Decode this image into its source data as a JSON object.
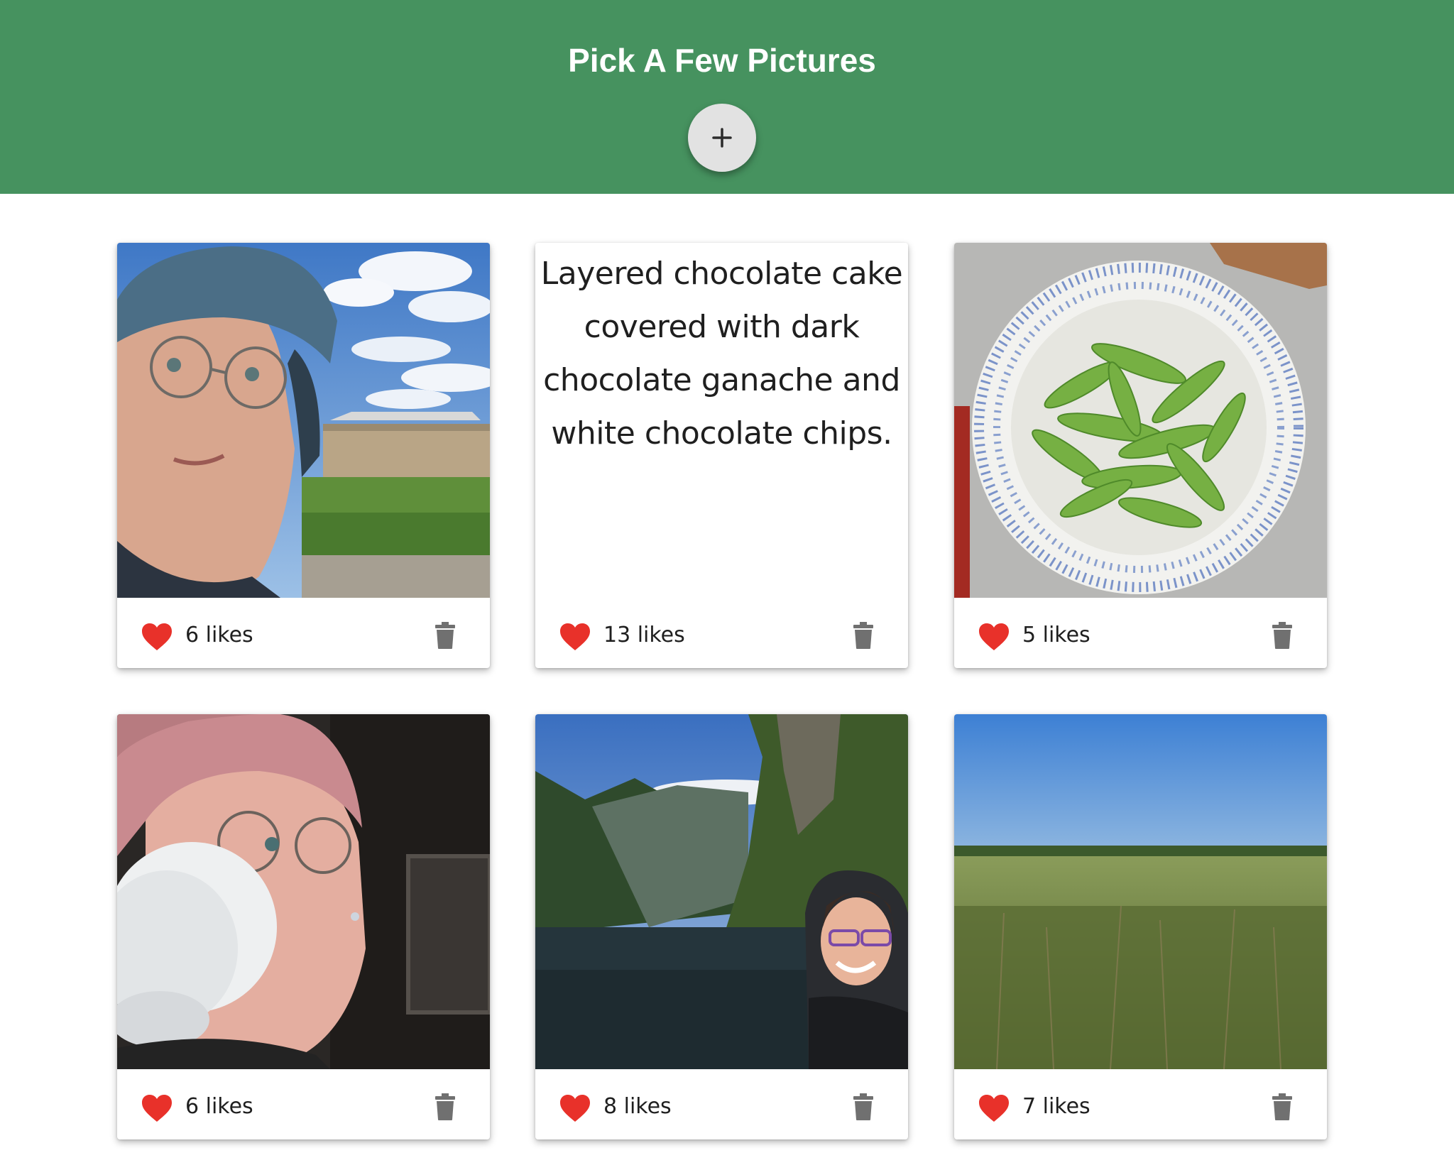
{
  "header": {
    "title": "Pick A Few Pictures",
    "add_button": {
      "icon": "plus-icon",
      "label": "+"
    },
    "background_color": "#46925f"
  },
  "cards": [
    {
      "kind": "photo",
      "subject": "selfie with bike helmet and glasses",
      "likes_text": "6 likes"
    },
    {
      "kind": "text",
      "caption": "Layered chocolate cake covered with dark chocolate ganache and white chocolate chips.",
      "likes_text": "13 likes"
    },
    {
      "kind": "photo",
      "subject": "bowl of edamame",
      "likes_text": "5 likes"
    },
    {
      "kind": "photo",
      "subject": "selfie drinking from coffee cup",
      "likes_text": "6 likes"
    },
    {
      "kind": "photo",
      "subject": "selfie in front of fjord",
      "likes_text": "8 likes"
    },
    {
      "kind": "photo",
      "subject": "grassy field under blue sky",
      "likes_text": "7 likes"
    }
  ],
  "icons": {
    "like": "heart-icon",
    "delete": "trash-icon"
  },
  "colors": {
    "heart": "#e8312a",
    "trash": "#707070"
  }
}
